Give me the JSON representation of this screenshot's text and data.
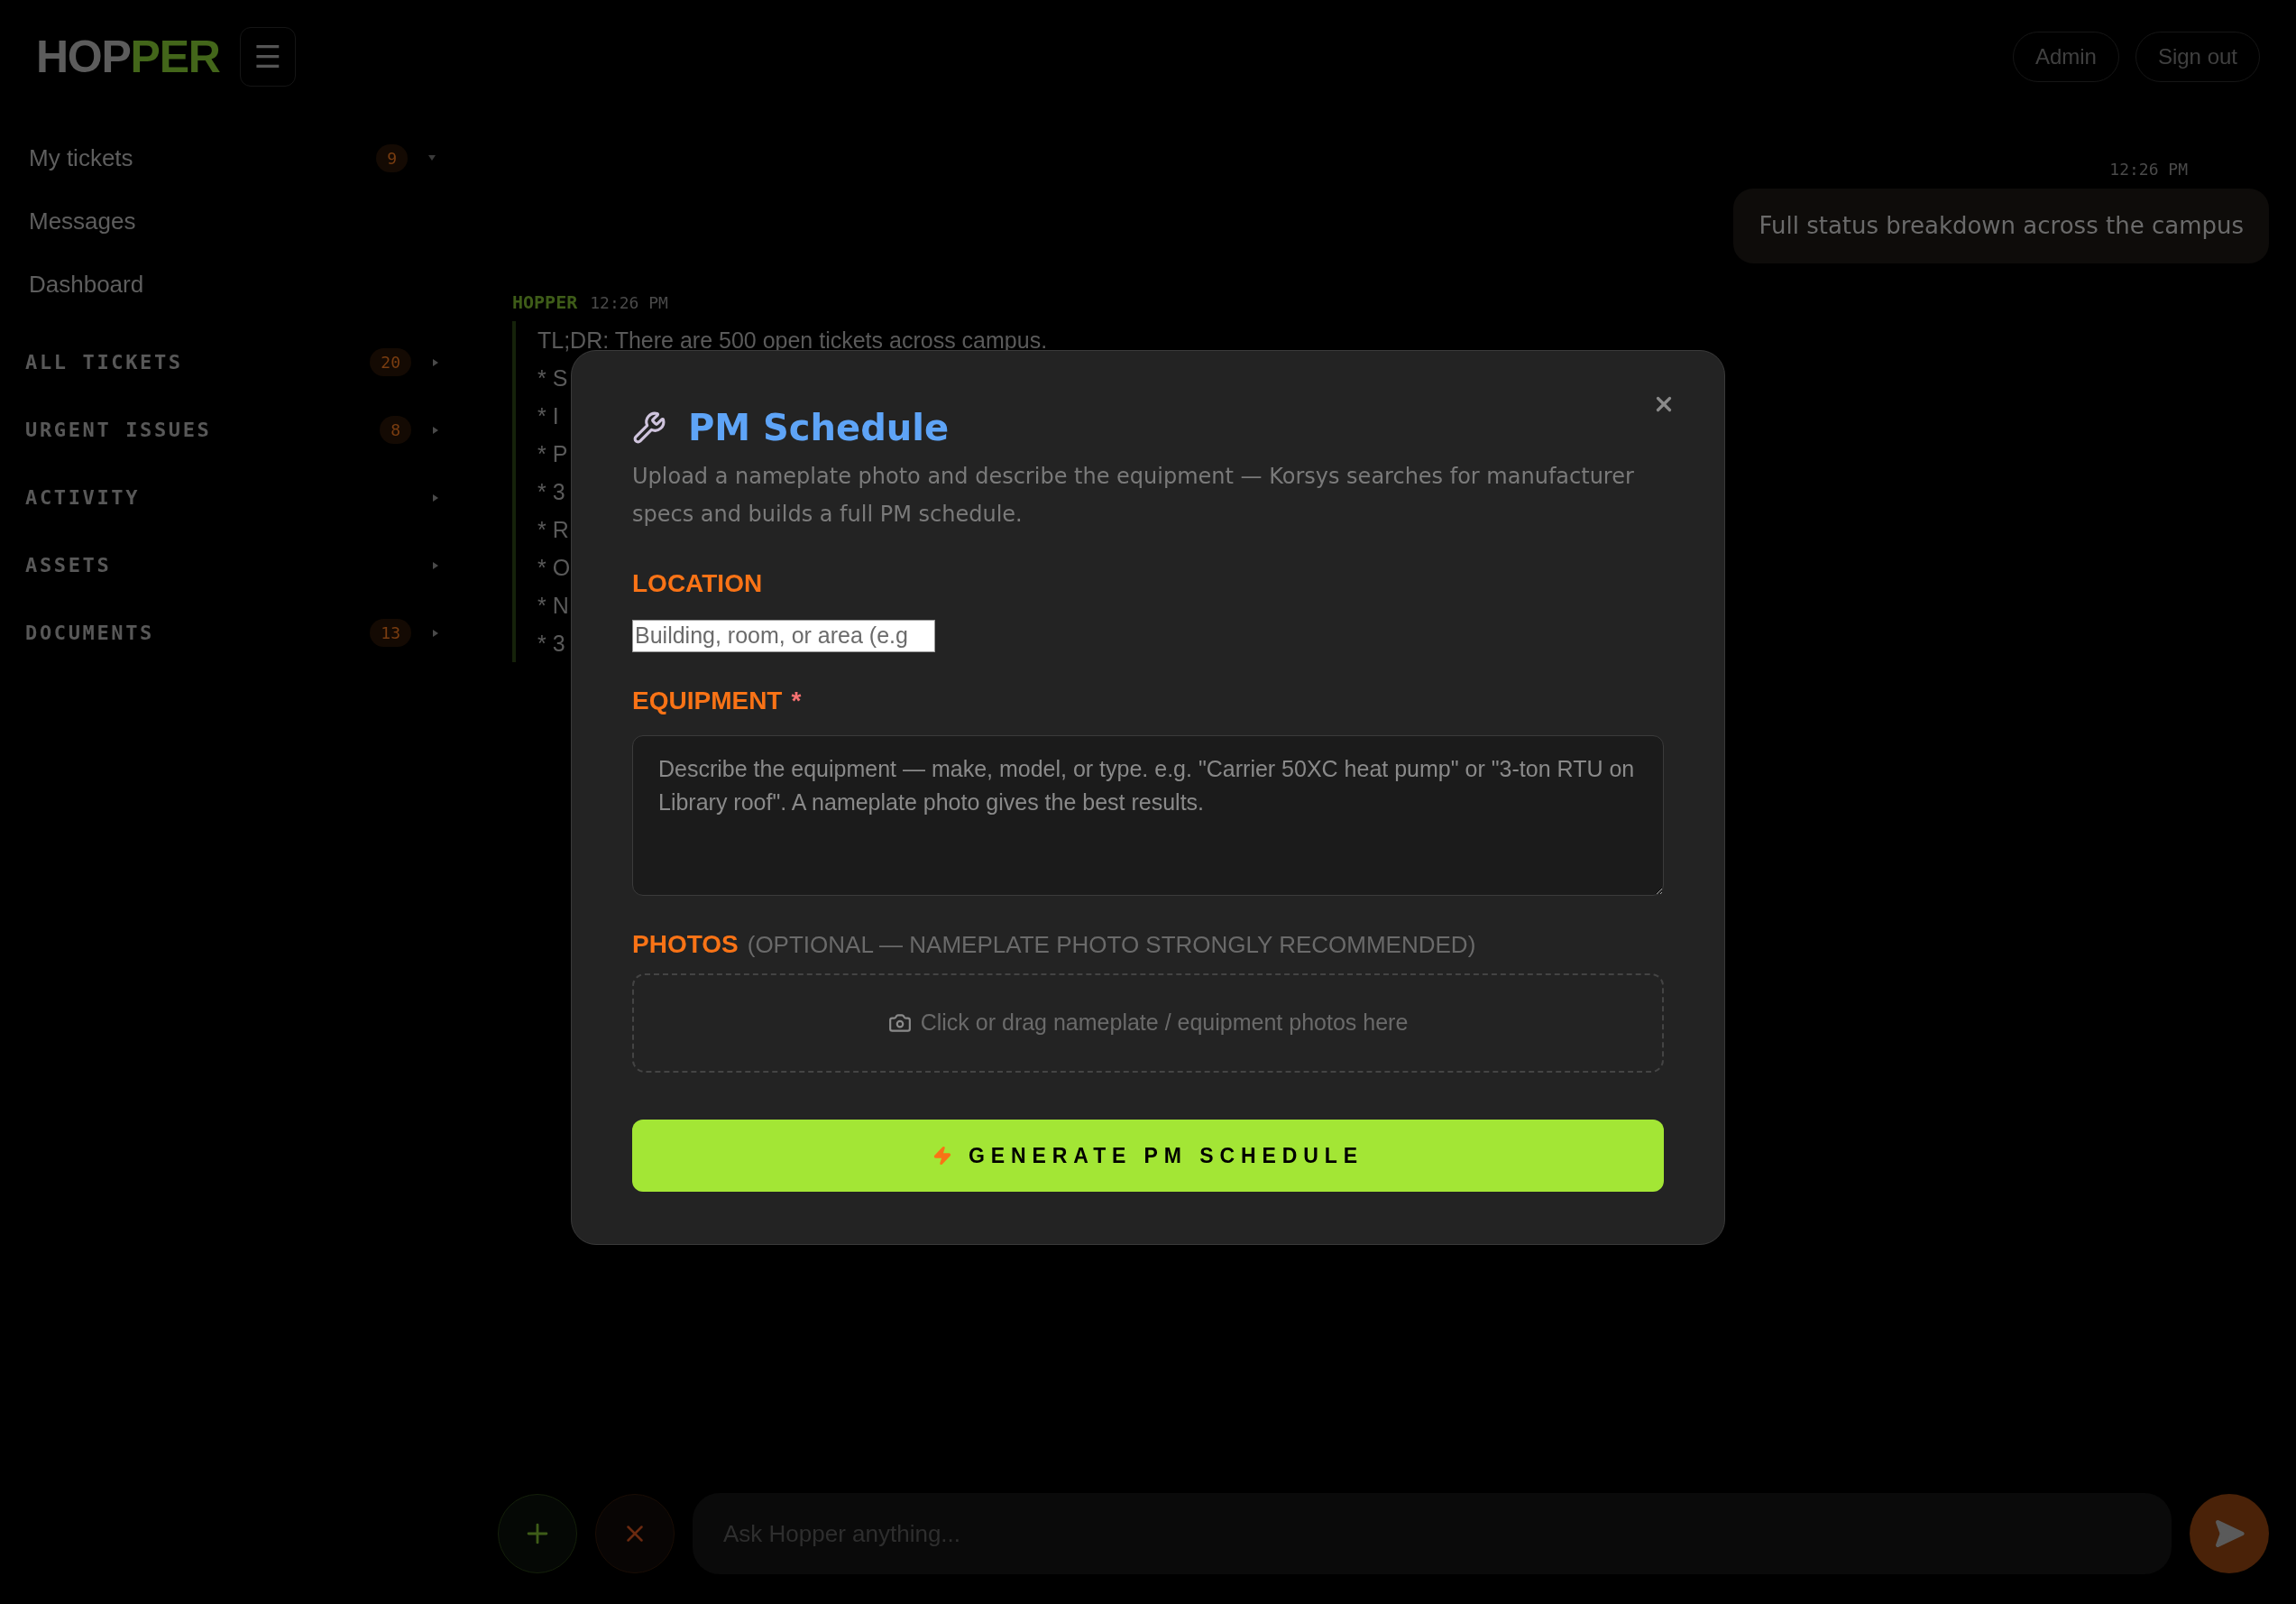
{
  "header": {
    "logo": {
      "part_1": "HOP",
      "part_2": "PER"
    },
    "menu_button": "☰",
    "buttons": [
      "Admin",
      "Sign out"
    ]
  },
  "sidebar": {
    "links": [
      {
        "label": "My tickets",
        "badge": "9",
        "expanded": true
      },
      {
        "label": "Messages"
      },
      {
        "label": "Dashboard"
      }
    ],
    "sections": [
      {
        "label": "ALL TICKETS",
        "badge": "20",
        "expanded": false
      },
      {
        "label": "URGENT ISSUES",
        "badge": "8",
        "expanded": false
      },
      {
        "label": "ACTIVITY",
        "expanded": false
      },
      {
        "label": "ASSETS",
        "expanded": false
      },
      {
        "label": "DOCUMENTS",
        "badge": "13",
        "expanded": false
      }
    ]
  },
  "chat": {
    "messages": [
      {
        "kind": "user",
        "time": "12:26 PM",
        "text": "Full status breakdown across the campus"
      },
      {
        "kind": "bot",
        "author": "HOPPER",
        "time": "12:26 PM",
        "lines": [
          "TL;DR: There are 500 open tickets across campus.",
          "* S",
          "* I",
          "* P",
          "* 3",
          "* R",
          "* O",
          "* N",
          "* 3"
        ]
      }
    ]
  },
  "composer": {
    "placeholder": "Ask Hopper anything..."
  },
  "modal": {
    "title": "PM Schedule",
    "description": "Upload a nameplate photo and describe the equipment — Korsys searches for manufacturer specs and builds a full PM schedule.",
    "fields": [
      {
        "kind": "text",
        "label": "LOCATION",
        "placeholder": "Building, room, or area (e.g"
      },
      {
        "kind": "textarea",
        "label": "EQUIPMENT",
        "required_mark": "*",
        "placeholder": "Describe the equipment — make, model, or type. e.g. \"Carrier 50XC heat pump\" or \"3-ton RTU on Library roof\". A nameplate photo gives the best results."
      },
      {
        "kind": "upload",
        "label": "PHOTOS",
        "hint": "(OPTIONAL — NAMEPLATE PHOTO STRONGLY RECOMMENDED)",
        "placeholder": "Click or drag nameplate / equipment photos here"
      }
    ],
    "submit": "GENERATE PM SCHEDULE"
  }
}
